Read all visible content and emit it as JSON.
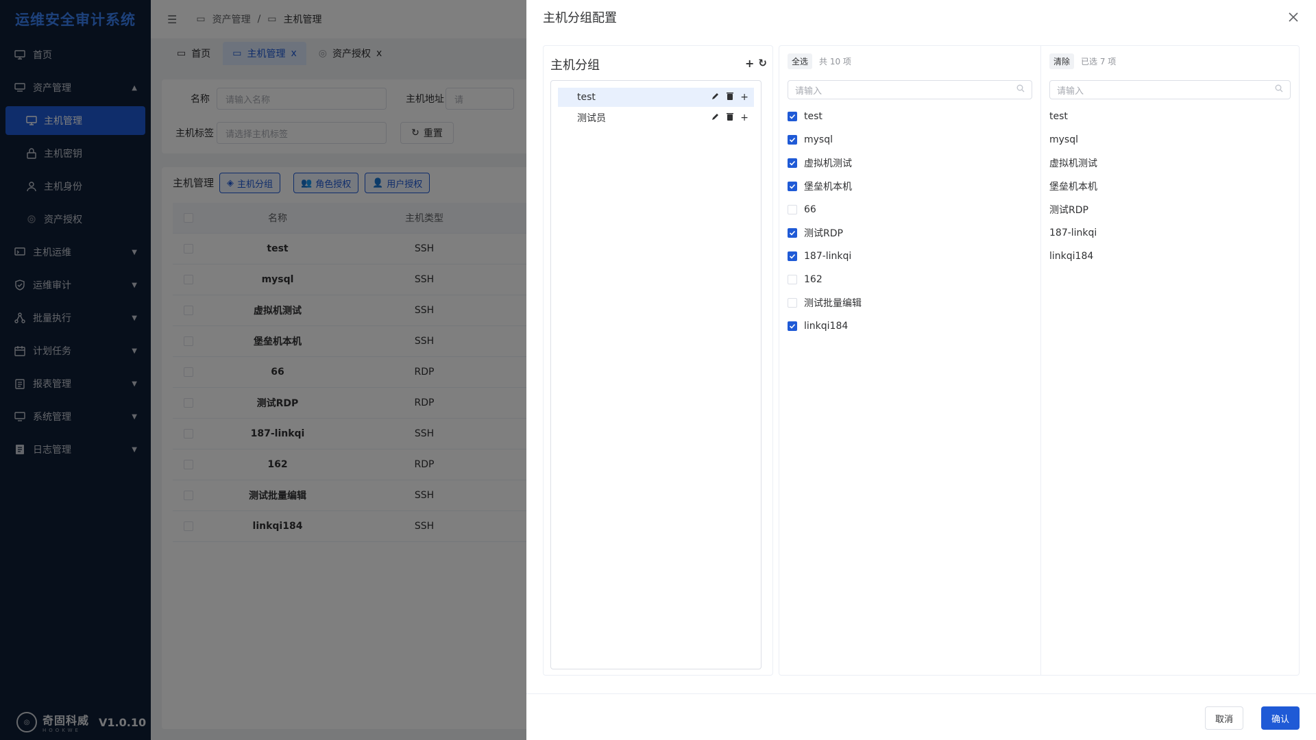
{
  "sidebar": {
    "title": "运维安全审计系统",
    "items": [
      {
        "label": "首页"
      },
      {
        "label": "资产管理"
      },
      {
        "label": "主机运维"
      },
      {
        "label": "运维审计"
      },
      {
        "label": "批量执行"
      },
      {
        "label": "计划任务"
      },
      {
        "label": "报表管理"
      },
      {
        "label": "系统管理"
      },
      {
        "label": "日志管理"
      }
    ],
    "subitems": [
      {
        "label": "主机管理"
      },
      {
        "label": "主机密钥"
      },
      {
        "label": "主机身份"
      },
      {
        "label": "资产授权"
      }
    ],
    "brand": "奇固科威",
    "brand_sub": "HOOKWE",
    "version": "V1.0.10"
  },
  "topbar": {
    "crumb1": "资产管理",
    "sep": "/",
    "crumb2": "主机管理"
  },
  "tabs": [
    {
      "label": "首页"
    },
    {
      "label": "主机管理",
      "close": "x"
    },
    {
      "label": "资产授权",
      "close": "x"
    }
  ],
  "filter": {
    "name_label": "名称",
    "name_placeholder": "请输入名称",
    "addr_label": "主机地址",
    "addr_placeholder": "请",
    "tag_label": "主机标签",
    "tag_placeholder": "请选择主机标签",
    "reset": "重置"
  },
  "table": {
    "title": "主机管理",
    "btn_group": "主机分组",
    "btn_role": "角色授权",
    "btn_user": "用户授权",
    "columns": [
      "名称",
      "主机类型"
    ],
    "rows": [
      {
        "name": "test",
        "type": "SSH"
      },
      {
        "name": "mysql",
        "type": "SSH"
      },
      {
        "name": "虚拟机测试",
        "type": "SSH"
      },
      {
        "name": "堡垒机本机",
        "type": "SSH"
      },
      {
        "name": "66",
        "type": "RDP"
      },
      {
        "name": "测试RDP",
        "type": "RDP"
      },
      {
        "name": "187-linkqi",
        "type": "SSH"
      },
      {
        "name": "162",
        "type": "RDP"
      },
      {
        "name": "测试批量编辑",
        "type": "SSH"
      },
      {
        "name": "linkqi184",
        "type": "SSH"
      }
    ]
  },
  "drawer": {
    "title": "主机分组配置",
    "group_title": "主机分组",
    "groups": [
      {
        "label": "test",
        "selected": true
      },
      {
        "label": "测试员",
        "selected": false
      }
    ],
    "left": {
      "select_all": "全选",
      "count": "共 10 项",
      "placeholder": "请输入",
      "items": [
        {
          "label": "test",
          "checked": true
        },
        {
          "label": "mysql",
          "checked": true
        },
        {
          "label": "虚拟机测试",
          "checked": true
        },
        {
          "label": "堡垒机本机",
          "checked": true
        },
        {
          "label": "66",
          "checked": false
        },
        {
          "label": "测试RDP",
          "checked": true
        },
        {
          "label": "187-linkqi",
          "checked": true
        },
        {
          "label": "162",
          "checked": false
        },
        {
          "label": "测试批量编辑",
          "checked": false
        },
        {
          "label": "linkqi184",
          "checked": true
        }
      ]
    },
    "right": {
      "clear": "清除",
      "count": "已选 7 项",
      "placeholder": "请输入",
      "items": [
        "test",
        "mysql",
        "虚拟机测试",
        "堡垒机本机",
        "测试RDP",
        "187-linkqi",
        "linkqi184"
      ]
    },
    "cancel": "取消",
    "confirm": "确认"
  },
  "colors": {
    "sidebar_bg": "#0f1e36",
    "accent": "#1f5ad6",
    "logo": "#3b82f6"
  }
}
